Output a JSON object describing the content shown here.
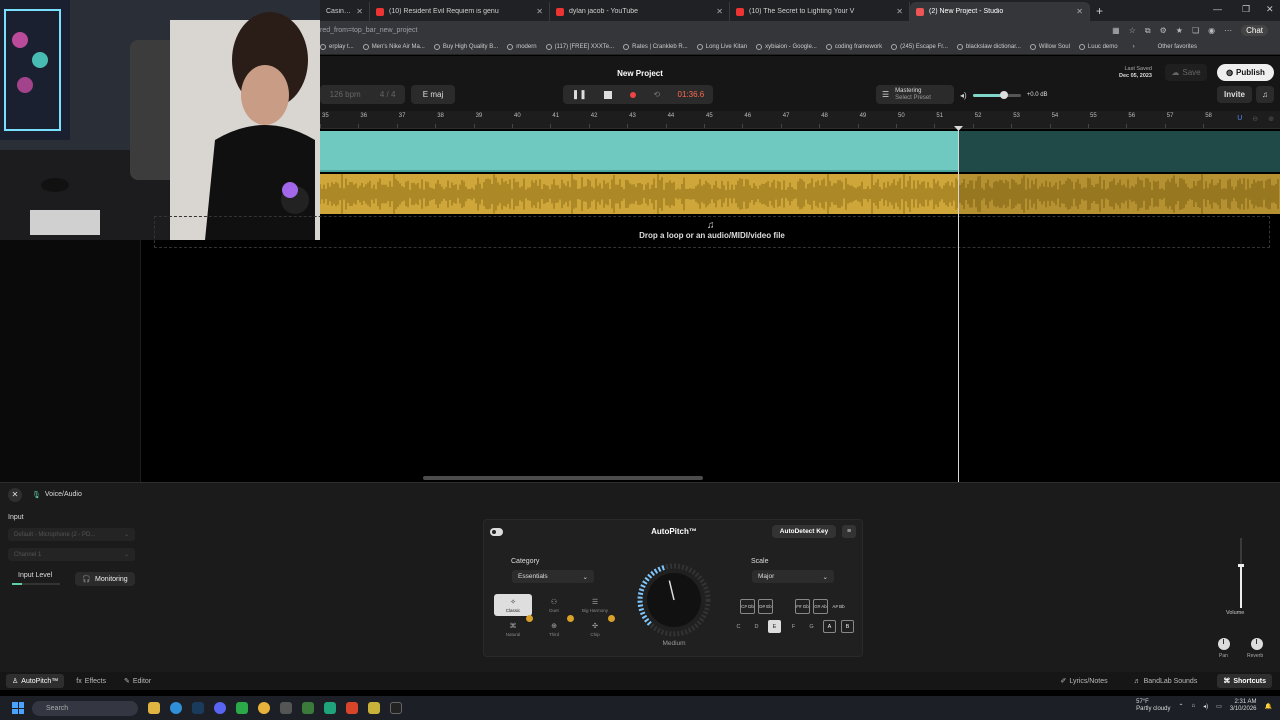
{
  "browser": {
    "tabs": [
      {
        "title": "Casino x Cloud F",
        "active": false
      },
      {
        "title": "(10) Resident Evil Requiem is genu",
        "active": false
      },
      {
        "title": "dylan jacob - YouTube",
        "active": false
      },
      {
        "title": "(10) The Secret to Lighting Your V",
        "active": false
      },
      {
        "title": "(2) New Project - Studio",
        "active": true
      }
    ],
    "url": "red_from=top_bar_new_project",
    "chat_label": "Chat",
    "bookmarks": [
      "erplay t...",
      "Men's Nike Air Ma...",
      "Buy High Quality B...",
      "modern",
      "(117) [FREE] XXXTe...",
      "Rates | Crankleb R...",
      "Long Live Kitan",
      "xybiaion - Google...",
      "coding framework",
      "(245) Escape Fr...",
      "blackslaw dictionar...",
      "Willow Soul",
      "Luuc demo"
    ],
    "other_favorites": "Other favorites"
  },
  "studio": {
    "project_title": "New Project",
    "tempo": "126",
    "tempo_unit": "bpm",
    "time_signature": "4 / 4",
    "key": "E maj",
    "time": "01:36.6",
    "mastering_label": "Mastering",
    "mastering_preset": "Select Preset",
    "master_volume": 0.65,
    "db_readout": "+0.0 dB",
    "last_saved_label": "Last Saved",
    "last_saved_date": "Dec 05, 2023",
    "save_label": "Save",
    "publish_label": "Publish",
    "invite_label": "Invite",
    "ruler_ticks": [
      "35",
      "36",
      "37",
      "38",
      "39",
      "40",
      "41",
      "42",
      "43",
      "44",
      "45",
      "46",
      "47",
      "48",
      "49",
      "50",
      "51",
      "52",
      "53",
      "54",
      "55",
      "56",
      "57",
      "58"
    ],
    "drop_text": "Drop a loop or an audio/MIDI/video file"
  },
  "voice_panel": {
    "title": "Voice/Audio",
    "input_label": "Input",
    "input_device": "Default - Microphone (2 - PD...",
    "input_channel": "Channel 1",
    "input_level_label": "Input Level",
    "input_level": 0.2,
    "monitoring_label": "Monitoring",
    "autopitch": {
      "title": "AutoPitch™",
      "autodetect_label": "AutoDetect Key",
      "category_label": "Category",
      "category_value": "Essentials",
      "presets": [
        "Classic",
        "Duet",
        "Big Harmony",
        "Natural",
        "Third",
        "Chip"
      ],
      "selected_preset": "Classic",
      "knob_label": "Medium",
      "knob_level": 0.45,
      "scale_label": "Scale",
      "scale_value": "Major",
      "sharp_keys": [
        "C# Db",
        "D# Eb",
        "F# Gb",
        "G# Ab",
        "A# Bb"
      ],
      "notes": [
        "C",
        "D",
        "E",
        "F",
        "G",
        "A",
        "B"
      ],
      "selected_note": "E"
    },
    "volume_label": "Volume",
    "volume_level": 0.6,
    "pan_label": "Pan",
    "reverb_label": "Reverb"
  },
  "bottom_tabs": {
    "autopitch": "AutoPitch™",
    "effects": "Effects",
    "editor": "Editor",
    "lyrics": "Lyrics/Notes",
    "sounds": "BandLab Sounds",
    "shortcuts": "Shortcuts"
  },
  "taskbar": {
    "search_placeholder": "Search",
    "weather_temp": "57°F",
    "weather_desc": "Partly cloudy",
    "time": "2:31 AM",
    "date": "3/10/2026"
  },
  "colors": {
    "midi_region": "#6fc9c0",
    "audio_region": "#cfa63a",
    "record": "#e44444",
    "time_readout": "#ff6a4d"
  }
}
